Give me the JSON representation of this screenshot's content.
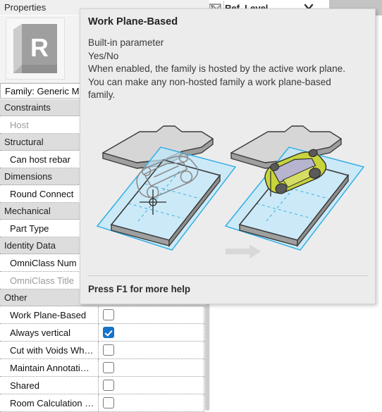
{
  "app": {
    "palette_title": "Properties",
    "family_label": "Family: Generic M",
    "icon_letter": "R"
  },
  "optionsbar": {
    "ref_level_label": "Ref. Level",
    "ref_level_icon": "level-datum-icon",
    "chevron_left_icon": "chevron-down-icon",
    "chevron_right_icon": "chevron-down-icon",
    "chevron_far_icon": "chevron-down-icon"
  },
  "parameters": [
    {
      "kind": "group",
      "label": "Constraints"
    },
    {
      "kind": "row",
      "label": "Host",
      "disabled": true,
      "value": "",
      "control": "text"
    },
    {
      "kind": "group",
      "label": "Structural"
    },
    {
      "kind": "row",
      "label": "Can host rebar",
      "disabled": false,
      "value": "",
      "control": "text"
    },
    {
      "kind": "group",
      "label": "Dimensions"
    },
    {
      "kind": "row",
      "label": "Round Connect",
      "disabled": false,
      "value": "",
      "control": "text"
    },
    {
      "kind": "group",
      "label": "Mechanical"
    },
    {
      "kind": "row",
      "label": "Part Type",
      "disabled": false,
      "value": "",
      "control": "text"
    },
    {
      "kind": "group",
      "label": "Identity Data"
    },
    {
      "kind": "row",
      "label": "OmniClass Num",
      "disabled": false,
      "value": "",
      "control": "text"
    },
    {
      "kind": "row",
      "label": "OmniClass Title",
      "disabled": true,
      "value": "",
      "control": "text"
    },
    {
      "kind": "group",
      "label": "Other"
    },
    {
      "kind": "row",
      "label": "Work Plane-Based",
      "disabled": false,
      "control": "checkbox",
      "checked": false
    },
    {
      "kind": "row",
      "label": "Always vertical",
      "disabled": false,
      "control": "checkbox",
      "checked": true
    },
    {
      "kind": "row",
      "label": "Cut with Voids Wh…",
      "disabled": false,
      "control": "checkbox",
      "checked": false
    },
    {
      "kind": "row",
      "label": "Maintain Annotati…",
      "disabled": false,
      "control": "checkbox",
      "checked": false
    },
    {
      "kind": "row",
      "label": "Shared",
      "disabled": false,
      "control": "checkbox",
      "checked": false
    },
    {
      "kind": "row",
      "label": "Room Calculation …",
      "disabled": false,
      "control": "checkbox",
      "checked": false
    }
  ],
  "tooltip": {
    "title": "Work Plane-Based",
    "line1": "Built-in parameter",
    "line2": "Yes/No",
    "line3": "When enabled, the family is hosted by the active work plane.",
    "line4": "You can make any non-hosted family a work plane-based",
    "line5": "family.",
    "footer": "Press F1 for more help",
    "illustration": {
      "name": "work-plane-based-illustration",
      "description": "Two isometric diagrams: a gray slab with a blue translucent work plane; a ghosted gray car on the left and a colored yellow-green car on the right, connected by a gray arrow.",
      "arrow_icon": "right-arrow-icon"
    }
  },
  "colors": {
    "accent_checkbox": "#1573c8",
    "group_header_bg": "#dddddd",
    "tooltip_bg": "#ececec",
    "workplane_fill": "#bfe8fb",
    "workplane_stroke": "#29ace3",
    "slab_fill": "#d6d6d6",
    "car_body": "#c8d43a",
    "arrow": "#d8d8d8"
  }
}
